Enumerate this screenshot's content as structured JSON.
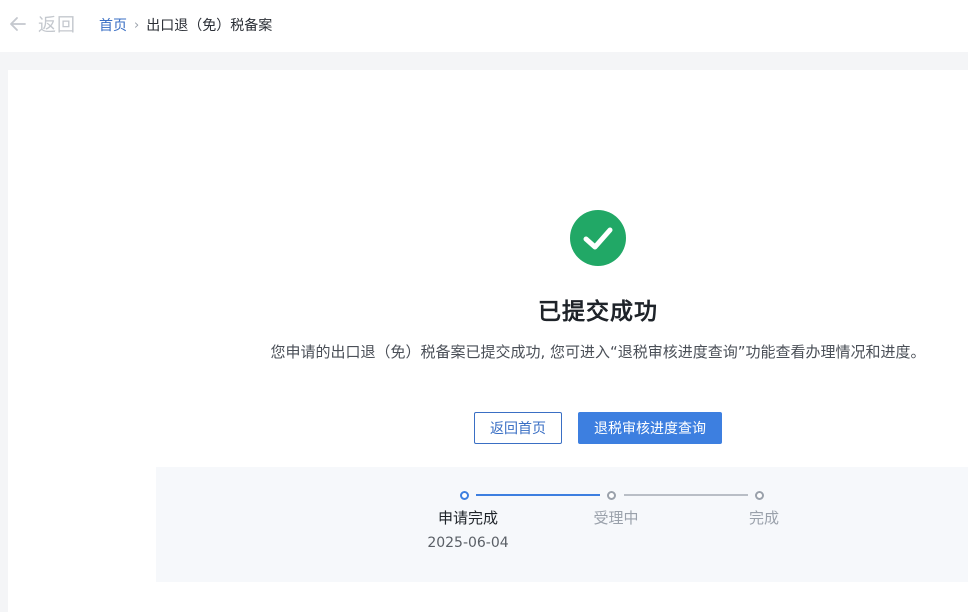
{
  "header": {
    "back_label": "返回",
    "breadcrumb_home": "首页",
    "breadcrumb_separator": "›",
    "breadcrumb_current": "出口退（免）税备案"
  },
  "result": {
    "title": "已提交成功",
    "description": "您申请的出口退（免）税备案已提交成功, 您可进入“退税审核进度查询”功能查看办理情况和进度。"
  },
  "actions": {
    "home_button": "返回首页",
    "query_button": "退税审核进度查询"
  },
  "steps": [
    {
      "label": "申请完成",
      "date": "2025-06-04",
      "status": "done"
    },
    {
      "label": "受理中",
      "date": "",
      "status": "pending"
    },
    {
      "label": "完成",
      "date": "",
      "status": "pending"
    }
  ],
  "colors": {
    "primary": "#3d7fe0",
    "success": "#21a866",
    "link": "#3a6fc4"
  },
  "icons": {
    "back": "arrow-left-icon",
    "success": "check-circle-icon"
  }
}
